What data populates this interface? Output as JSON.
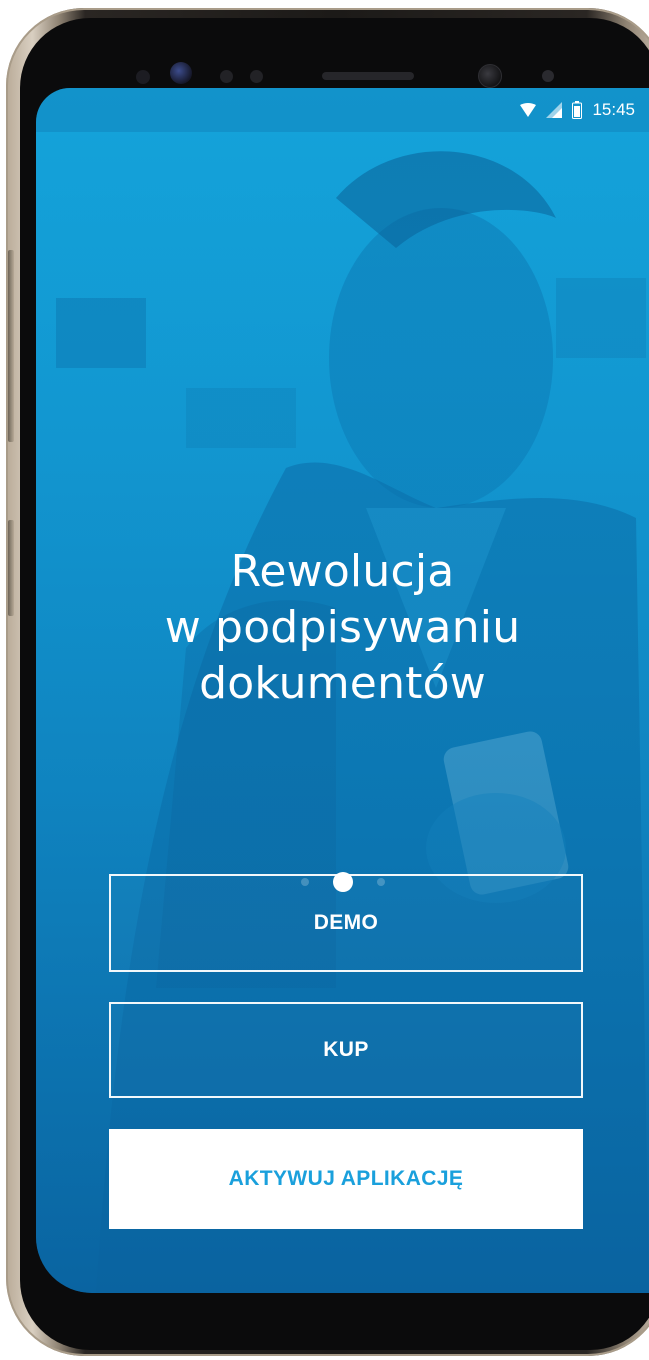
{
  "status_bar": {
    "time": "15:45",
    "icons": [
      "wifi-icon",
      "signal-icon",
      "battery-icon"
    ]
  },
  "onboarding": {
    "headline_lines": [
      "Rewolucja",
      "w podpisywaniu",
      "dokumentów"
    ],
    "pager": {
      "total": 3,
      "active_index": 1
    }
  },
  "actions": {
    "demo_label": "DEMO",
    "buy_label": "KUP",
    "activate_label": "AKTYWUJ APLIKACJĘ"
  },
  "colors": {
    "screen_overlay": "#1297d1",
    "accent": "#1aa0dc",
    "text": "#ffffff"
  }
}
